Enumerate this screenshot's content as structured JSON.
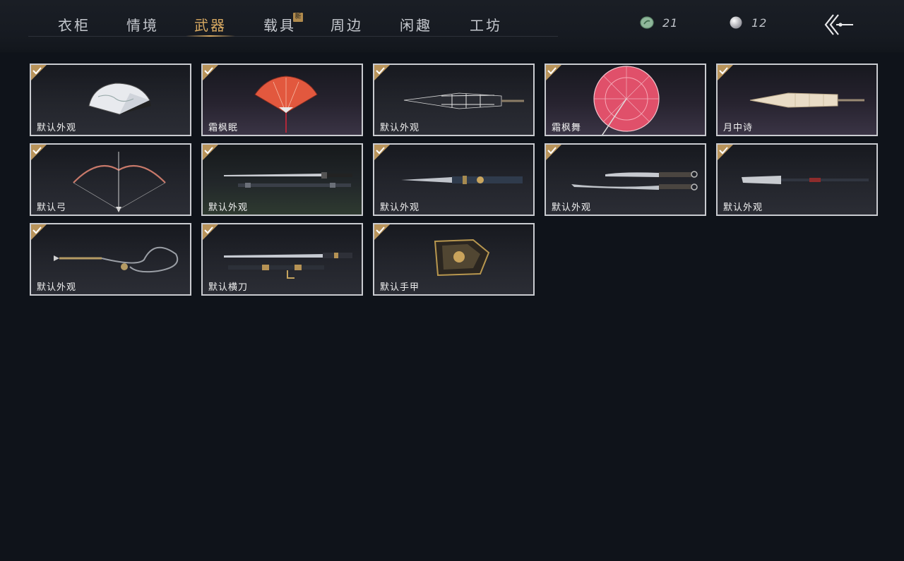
{
  "tabs": [
    {
      "label": "衣柜"
    },
    {
      "label": "情境"
    },
    {
      "label": "武器",
      "active": true
    },
    {
      "label": "载具",
      "badge": "新"
    },
    {
      "label": "周边"
    },
    {
      "label": "闲趣"
    },
    {
      "label": "工坊"
    }
  ],
  "currencies": [
    {
      "icon": "jade-coin-icon",
      "value": "21"
    },
    {
      "icon": "pearl-icon",
      "value": "12"
    }
  ],
  "items": [
    {
      "label": "默认外观",
      "icon": "folding-fan-white-icon",
      "owned": true
    },
    {
      "label": "霜枫眠",
      "icon": "folding-fan-red-icon",
      "owned": true
    },
    {
      "label": "默认外观",
      "icon": "closed-umbrella-icon",
      "owned": true
    },
    {
      "label": "霜枫舞",
      "icon": "open-umbrella-pink-icon",
      "owned": true
    },
    {
      "label": "月中诗",
      "icon": "closed-umbrella-cream-icon",
      "owned": true
    },
    {
      "label": "默认弓",
      "icon": "bow-icon",
      "owned": true
    },
    {
      "label": "默认外观",
      "icon": "sword-and-scabbard-icon",
      "owned": true
    },
    {
      "label": "默认外观",
      "icon": "spear-blade-icon",
      "owned": true
    },
    {
      "label": "默认外观",
      "icon": "twin-sabres-icon",
      "owned": true
    },
    {
      "label": "默认外观",
      "icon": "glaive-icon",
      "owned": true
    },
    {
      "label": "默认外观",
      "icon": "rope-dart-icon",
      "owned": true
    },
    {
      "label": "默认横刀",
      "icon": "hengdao-icon",
      "owned": true
    },
    {
      "label": "默认手甲",
      "icon": "gauntlet-icon",
      "owned": true
    }
  ]
}
